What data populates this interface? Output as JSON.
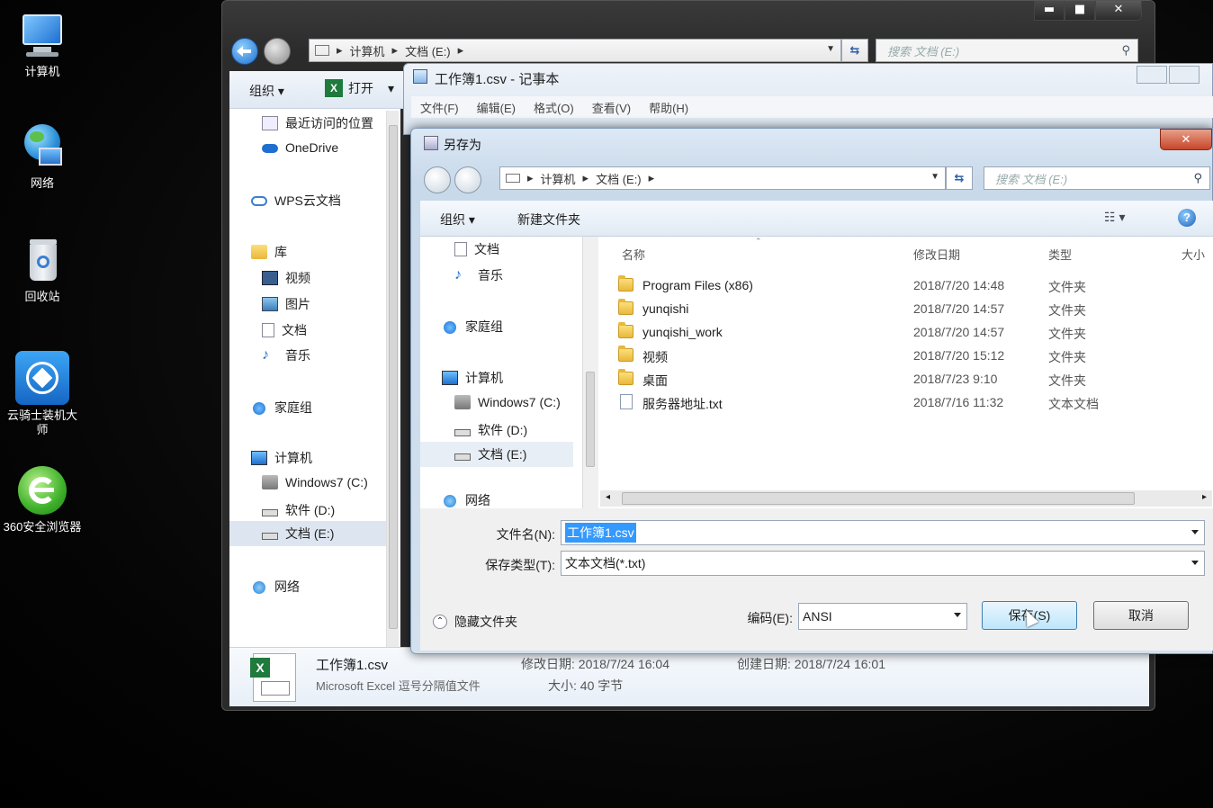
{
  "desktop": {
    "icons": [
      {
        "label": "计算机"
      },
      {
        "label": "网络"
      },
      {
        "label": "回收站"
      },
      {
        "label": "云骑士装机大师"
      },
      {
        "label": "360安全浏览器"
      }
    ]
  },
  "explorer": {
    "window_buttons": {
      "min": "▬",
      "max": "■",
      "close": "✕"
    },
    "address": {
      "root": "计算机",
      "drive": "文档 (E:)"
    },
    "search_placeholder": "搜索 文档 (E:)",
    "toolbar": {
      "organize": "组织",
      "open": "打开"
    },
    "sidebar": [
      {
        "label": "最近访问的位置"
      },
      {
        "label": "OneDrive"
      },
      {
        "label": "WPS云文档"
      },
      {
        "label": "库"
      },
      {
        "label": "视频"
      },
      {
        "label": "图片"
      },
      {
        "label": "文档"
      },
      {
        "label": "音乐"
      },
      {
        "label": "家庭组"
      },
      {
        "label": "计算机"
      },
      {
        "label": "Windows7 (C:)"
      },
      {
        "label": "软件 (D:)"
      },
      {
        "label": "文档 (E:)"
      },
      {
        "label": "网络"
      }
    ],
    "details": {
      "filename": "工作簿1.csv",
      "filetype": "Microsoft Excel 逗号分隔值文件",
      "modified": "修改日期: 2018/7/24 16:04",
      "size": "大小: 40 字节",
      "created": "创建日期: 2018/7/24 16:01"
    }
  },
  "notepad": {
    "title": "工作簿1.csv - 记事本",
    "menu": [
      "文件(F)",
      "编辑(E)",
      "格式(O)",
      "查看(V)",
      "帮助(H)"
    ]
  },
  "dialog": {
    "title": "另存为",
    "close": "✕",
    "address": {
      "root": "计算机",
      "drive": "文档 (E:)"
    },
    "search_placeholder": "搜索 文档 (E:)",
    "toolbar": {
      "organize": "组织",
      "new_folder": "新建文件夹"
    },
    "nav": [
      {
        "label": "文档"
      },
      {
        "label": "音乐"
      },
      {
        "label": "家庭组"
      },
      {
        "label": "计算机"
      },
      {
        "label": "Windows7 (C:)"
      },
      {
        "label": "软件 (D:)"
      },
      {
        "label": "文档 (E:)"
      },
      {
        "label": "网络"
      }
    ],
    "columns": {
      "name": "名称",
      "modified": "修改日期",
      "type": "类型",
      "size": "大小"
    },
    "files": [
      {
        "name": "Program Files (x86)",
        "modified": "2018/7/20 14:48",
        "type": "文件夹",
        "kind": "folder"
      },
      {
        "name": "yunqishi",
        "modified": "2018/7/20 14:57",
        "type": "文件夹",
        "kind": "folder"
      },
      {
        "name": "yunqishi_work",
        "modified": "2018/7/20 14:57",
        "type": "文件夹",
        "kind": "folder"
      },
      {
        "name": "视频",
        "modified": "2018/7/20 15:12",
        "type": "文件夹",
        "kind": "folder"
      },
      {
        "name": "桌面",
        "modified": "2018/7/23 9:10",
        "type": "文件夹",
        "kind": "folder"
      },
      {
        "name": "服务器地址.txt",
        "modified": "2018/7/16 11:32",
        "type": "文本文档",
        "kind": "txt"
      }
    ],
    "filename_label": "文件名(N):",
    "filename_value": "工作簿1.csv",
    "savetype_label": "保存类型(T):",
    "savetype_value": "文本文档(*.txt)",
    "hide_folders": "隐藏文件夹",
    "encoding_label": "编码(E):",
    "encoding_value": "ANSI",
    "save_button": "保存(S)",
    "cancel_button": "取消"
  }
}
